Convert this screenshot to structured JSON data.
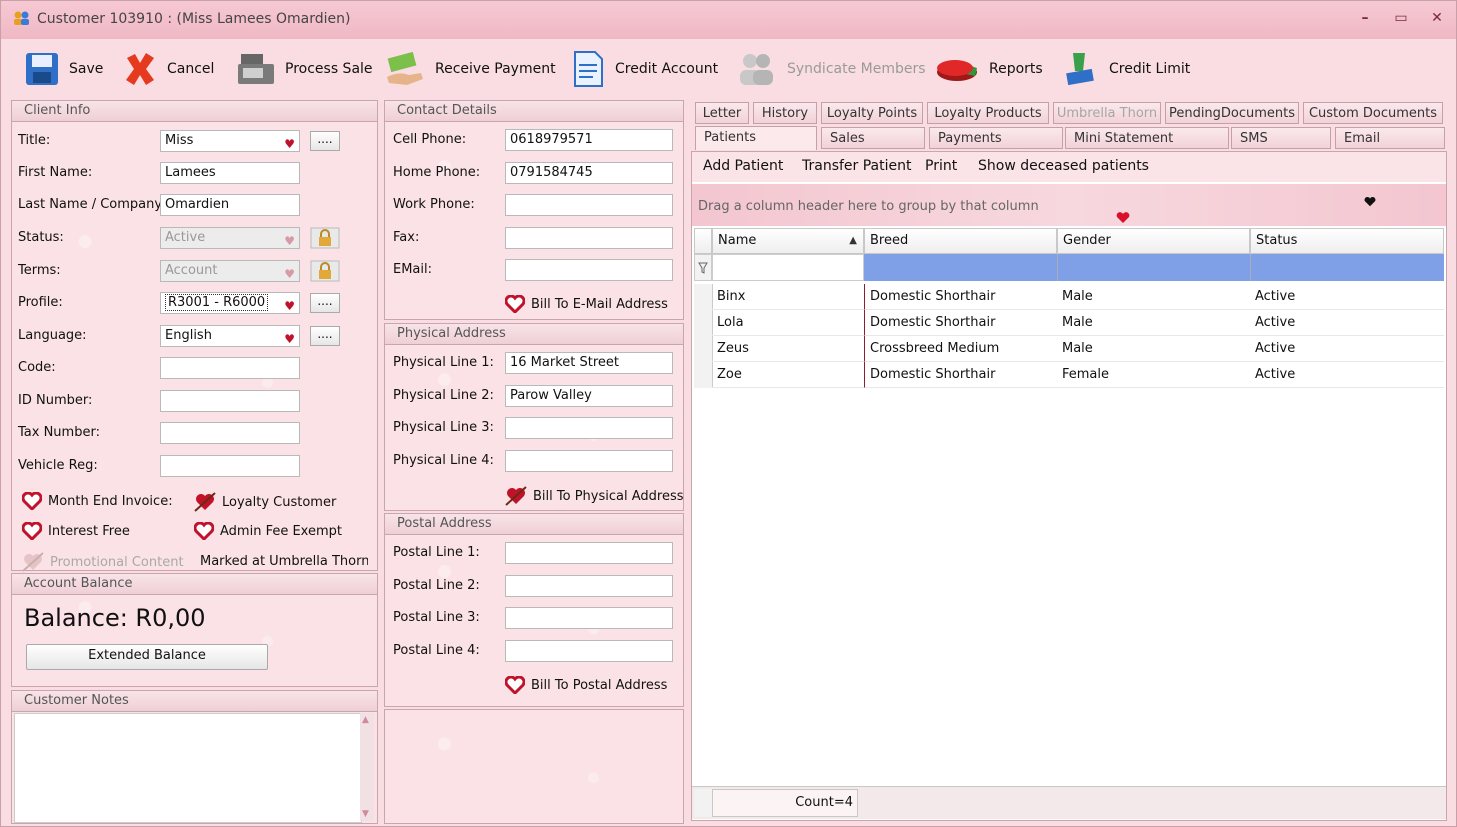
{
  "window": {
    "title": "Customer 103910 : (Miss Lamees Omardien)",
    "controls": {
      "minimize": "–",
      "maximize": "▭",
      "close": "✕"
    }
  },
  "toolbar": {
    "save": "Save",
    "cancel": "Cancel",
    "process_sale": "Process Sale",
    "receive_payment": "Receive Payment",
    "credit_account": "Credit Account",
    "syndicate_members": "Syndicate Members",
    "reports": "Reports",
    "credit_limit": "Credit Limit"
  },
  "client_info": {
    "header": "Client Info",
    "title_label": "Title:",
    "title_value": "Miss",
    "first_name_label": "First Name:",
    "first_name_value": "Lamees",
    "last_name_label": "Last Name / Company:",
    "last_name_value": "Omardien",
    "status_label": "Status:",
    "status_value": "Active",
    "terms_label": "Terms:",
    "terms_value": "Account",
    "profile_label": "Profile:",
    "profile_value": "R3001 - R6000",
    "language_label": "Language:",
    "language_value": "English",
    "code_label": "Code:",
    "code_value": "",
    "id_label": "ID Number:",
    "id_value": "",
    "tax_label": "Tax Number:",
    "tax_value": "",
    "vehicle_label": "Vehicle Reg:",
    "vehicle_value": "",
    "dots": "....",
    "month_end_invoice": "Month End Invoice:",
    "loyalty_customer": "Loyalty Customer",
    "interest_free": "Interest Free",
    "admin_fee_exempt": "Admin Fee Exempt",
    "promotional_content": "Promotional Content",
    "marked_umbrella": "Marked at Umbrella Thorn"
  },
  "account_balance": {
    "header": "Account Balance",
    "balance": "Balance: R0,00",
    "extended_button": "Extended Balance"
  },
  "customer_notes": {
    "header": "Customer Notes",
    "value": ""
  },
  "contact": {
    "header": "Contact Details",
    "cell_label": "Cell Phone:",
    "cell_value": "0618979571",
    "home_label": "Home Phone:",
    "home_value": "0791584745",
    "work_label": "Work Phone:",
    "work_value": "",
    "fax_label": "Fax:",
    "fax_value": "",
    "email_label": "EMail:",
    "email_value": "",
    "bill_email": "Bill To E-Mail Address"
  },
  "physical": {
    "header": "Physical Address",
    "l1_label": "Physical Line 1:",
    "l1_value": "16 Market Street",
    "l2_label": "Physical Line 2:",
    "l2_value": "Parow Valley",
    "l3_label": "Physical Line 3:",
    "l3_value": "",
    "l4_label": "Physical Line 4:",
    "l4_value": "",
    "bill": "Bill To Physical Address"
  },
  "postal": {
    "header": "Postal Address",
    "l1_label": "Postal Line 1:",
    "l1_value": "",
    "l2_label": "Postal Line 2:",
    "l2_value": "",
    "l3_label": "Postal Line 3:",
    "l3_value": "",
    "l4_label": "Postal Line 4:",
    "l4_value": "",
    "bill": "Bill To Postal Address"
  },
  "tabs": {
    "row1": [
      "Letter",
      "History",
      "Loyalty Points",
      "Loyalty Products",
      "Umbrella Thorn",
      "PendingDocuments",
      "Custom Documents"
    ],
    "row2": [
      "Patients",
      "Sales",
      "Payments",
      "Mini Statement",
      "SMS",
      "Email"
    ]
  },
  "patients": {
    "actions": [
      "Add Patient",
      "Transfer Patient",
      "Print",
      "Show deceased patients"
    ],
    "group_hint": "Drag a column header here to group by that column",
    "columns": [
      "Name",
      "Breed",
      "Gender",
      "Status"
    ],
    "rows": [
      [
        "Binx",
        "Domestic Shorthair",
        "Male",
        "Active"
      ],
      [
        "Lola",
        "Domestic Shorthair",
        "Male",
        "Active"
      ],
      [
        "Zeus",
        "Crossbreed Medium",
        "Male",
        "Active"
      ],
      [
        "Zoe",
        "Domestic Shorthair",
        "Female",
        "Active"
      ]
    ],
    "count": "Count=4"
  },
  "colors": {
    "heart": "#c0132b",
    "selected_filter": "#7f9fe6",
    "window_bg": "#f9dde2"
  }
}
